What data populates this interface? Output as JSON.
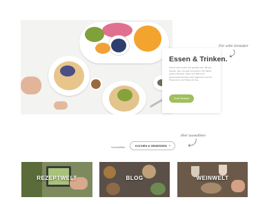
{
  "hero": {
    "title": "Essen & Trinken.",
    "body": "Gutes Leben kocht und genießt man. Mit der Familie, oder mit guten Freunden. Wir haben leckere Rezepte, Ideen und Weine für genussvolle Stunden einer Tageszeit und Ihre Thermomix und Trinken für Sie.",
    "button": "Zum Rezept",
    "note": "Für volle Genießer"
  },
  "filter": {
    "note": "Hier auswählen",
    "label": "Schnellfilter",
    "selected": "KOCHEN & GENIESSEN"
  },
  "tiles": [
    {
      "label": "REZEPTWELT"
    },
    {
      "label": "BLOG"
    },
    {
      "label": "WEINWELT"
    }
  ],
  "colors": {
    "accent": "#9fbf5a"
  }
}
